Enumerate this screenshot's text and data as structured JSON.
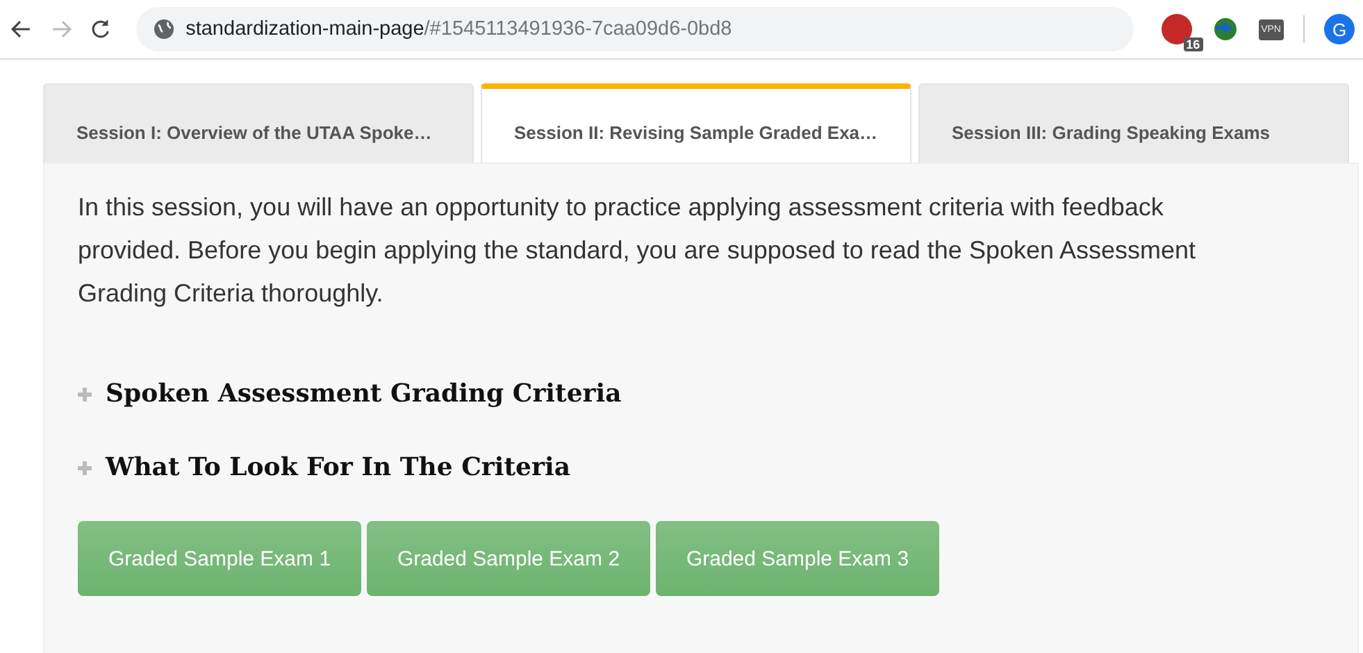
{
  "browser": {
    "url_host": "standardization-main-page",
    "url_rest": "/#1545113491936-7caa09d6-0bd8",
    "adblock_badge": "16",
    "vpn_label": "VPN",
    "profile_initial": "G"
  },
  "tabs": [
    {
      "label": "Session I: Overview of the UTAA Spoke…",
      "selected": false
    },
    {
      "label": "Session II: Revising Sample Graded Exa…",
      "selected": true
    },
    {
      "label": "Session III: Grading Speaking Exams",
      "selected": false
    }
  ],
  "intro": "In this session, you will have an opportunity to practice applying assessment criteria with feedback provided. Before you begin applying the standard, you are supposed to read the Spoken Assessment Grading Criteria thoroughly.",
  "sections": [
    {
      "title": "Spoken Assessment Grading Criteria",
      "expanded": false
    },
    {
      "title": "What To Look For In The Criteria",
      "expanded": false
    }
  ],
  "buttons": [
    "Graded Sample Exam 1",
    "Graded Sample Exam 2",
    "Graded Sample Exam 3"
  ]
}
